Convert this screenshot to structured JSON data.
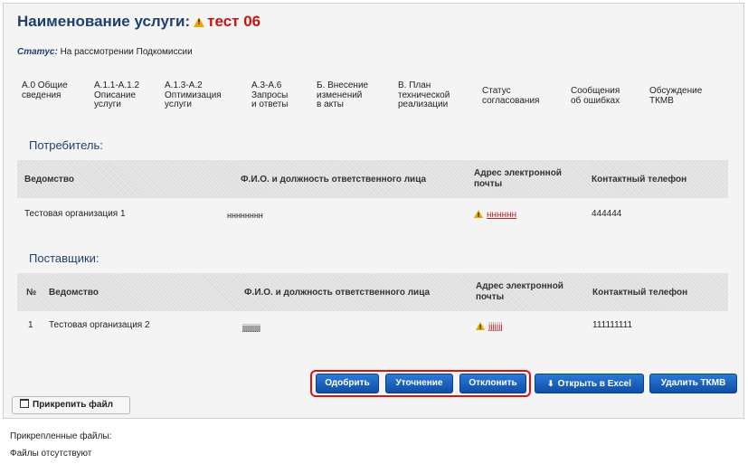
{
  "title": {
    "prefix": "Наименование услуги:",
    "name": "тест 06"
  },
  "status": {
    "label": "Статус:",
    "value": "На рассмотрении Подкомиссии"
  },
  "tabs": [
    {
      "label": "А.0 Общие\nсведения"
    },
    {
      "label": "А.1.1-А.1.2\nОписание\nуслуги"
    },
    {
      "label": "А.1.3-А.2\nОптимизация\nуслуги"
    },
    {
      "label": "А.3-А.6\nЗапросы\nи ответы"
    },
    {
      "label": "Б. Внесение\nизменений\nв акты"
    },
    {
      "label": "В. План\nтехнической\nреализации"
    },
    {
      "label": "Статус\nсогласования"
    },
    {
      "label": "Сообщения\nоб ошибках"
    },
    {
      "label": "Обсуждение\nТКМВ"
    }
  ],
  "consumer": {
    "title": "Потребитель:",
    "headers": {
      "agency": "Ведомство",
      "person": "Ф.И.О. и должность ответственного лица",
      "email": "Адрес электронной почты",
      "phone": "Контактный телефон"
    },
    "row": {
      "agency": "Тестовая организация 1",
      "person": "нннннннн",
      "email": "нннннн",
      "phone": "444444"
    }
  },
  "suppliers": {
    "title": "Поставщики:",
    "headers": {
      "num": "№",
      "agency": "Ведомство",
      "person": "Ф.И.О. и должность ответственного лица",
      "email": "Адрес электронной почты",
      "phone": "Контактный телефон"
    },
    "row": {
      "num": "1",
      "agency": "Тестовая организация 2",
      "person": "jjjjjjjjjj",
      "email": "jjjjjjj",
      "phone": "111111111"
    }
  },
  "buttons": {
    "approve": "Одобрить",
    "clarify": "Уточнение",
    "reject": "Отклонить",
    "excel": "Открыть в Excel",
    "delete": "Удалить ТКМВ"
  },
  "attach": {
    "button": "Прикрепить файл",
    "files_label": "Прикрепленные файлы:",
    "files_empty": "Файлы отсутствуют"
  },
  "colors": {
    "accent": "#1f3f6e",
    "danger": "#cc1111",
    "button": "#1560bd"
  }
}
